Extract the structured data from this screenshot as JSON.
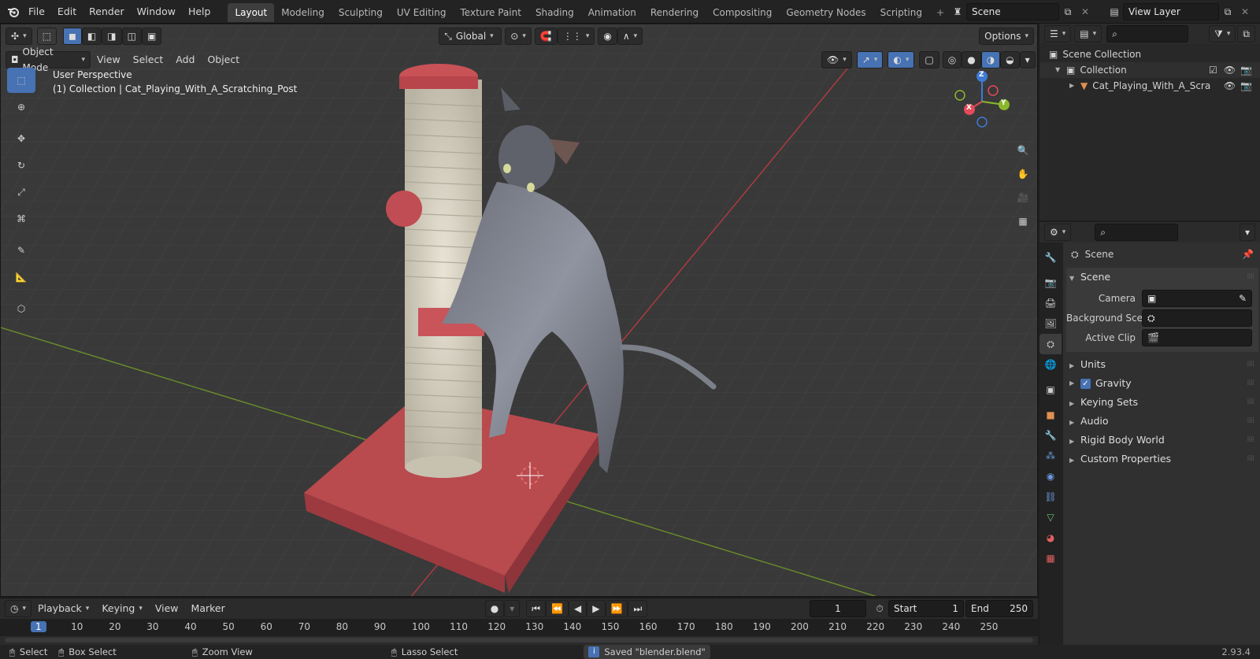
{
  "topbar": {
    "menus": [
      "File",
      "Edit",
      "Render",
      "Window",
      "Help"
    ],
    "workspaces": [
      "Layout",
      "Modeling",
      "Sculpting",
      "UV Editing",
      "Texture Paint",
      "Shading",
      "Animation",
      "Rendering",
      "Compositing",
      "Geometry Nodes",
      "Scripting"
    ],
    "active_workspace": "Layout",
    "scene_name": "Scene",
    "view_layer": "View Layer"
  },
  "viewport": {
    "header": {
      "mode": "Object Mode",
      "menus": [
        "View",
        "Select",
        "Add",
        "Object"
      ],
      "orientation": "Global",
      "options": "Options"
    },
    "overlay_text": {
      "perspective": "User Perspective",
      "collection": "(1) Collection | Cat_Playing_With_A_Scratching_Post"
    },
    "gizmo_axes": {
      "x": "X",
      "y": "Y",
      "z": "Z"
    },
    "colors": {
      "x_axis": "#e54a5a",
      "y_axis": "#8ab82c",
      "z_axis": "#3e7bd6",
      "accent": "#4772b3"
    }
  },
  "timeline": {
    "menus": [
      "Playback",
      "Keying",
      "View",
      "Marker"
    ],
    "current_frame": "1",
    "start_label": "Start",
    "start": "1",
    "end_label": "End",
    "end": "250",
    "ruler": [
      "1",
      "10",
      "20",
      "30",
      "40",
      "50",
      "60",
      "70",
      "80",
      "90",
      "100",
      "110",
      "120",
      "130",
      "140",
      "150",
      "160",
      "170",
      "180",
      "190",
      "200",
      "210",
      "220",
      "230",
      "240",
      "250"
    ]
  },
  "statusbar": {
    "select": "Select",
    "box_select": "Box Select",
    "zoom_view": "Zoom View",
    "lasso_select": "Lasso Select",
    "message": "Saved \"blender.blend\"",
    "version": "2.93.4"
  },
  "outliner": {
    "root": "Scene Collection",
    "collection": "Collection",
    "object": "Cat_Playing_With_A_Scra"
  },
  "properties": {
    "context": "Scene",
    "panel_title": "Scene",
    "fields": [
      {
        "label": "Camera",
        "value": ""
      },
      {
        "label": "Background Sce...",
        "value": ""
      },
      {
        "label": "Active Clip",
        "value": ""
      }
    ],
    "subpanels": [
      "Units",
      "Gravity",
      "Keying Sets",
      "Audio",
      "Rigid Body World",
      "Custom Properties"
    ],
    "gravity_checked": true
  }
}
